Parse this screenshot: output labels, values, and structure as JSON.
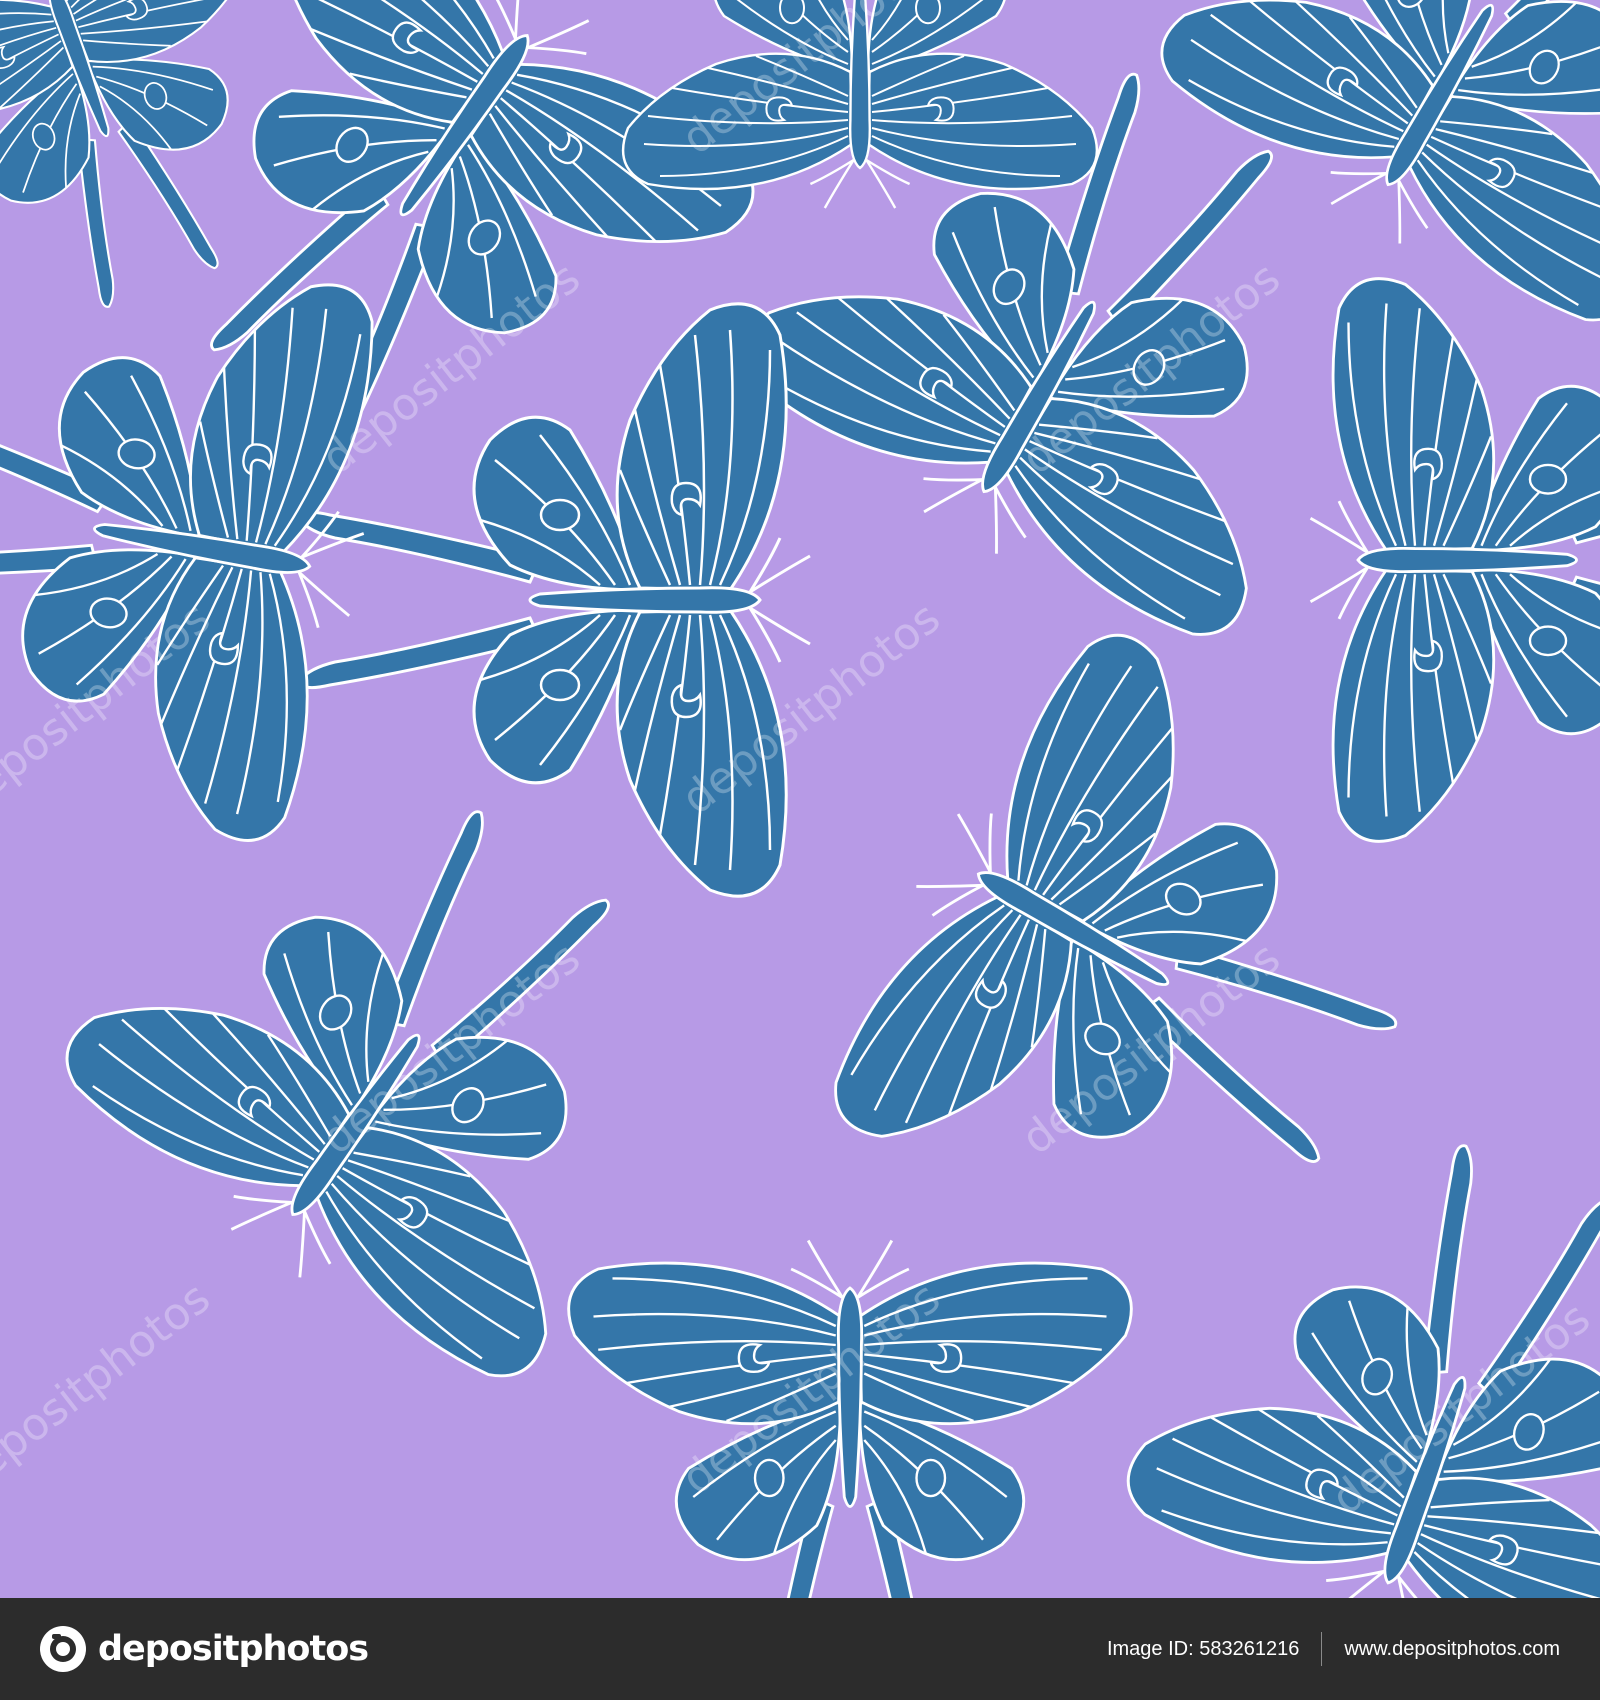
{
  "colors": {
    "background": "#b79ae6",
    "moth_fill": "#3476a9",
    "moth_outline": "#ffffff",
    "footer_bg": "#2c2c2c"
  },
  "pattern": {
    "subject": "luna moth",
    "moth_count": 12
  },
  "watermark": {
    "text": "depositphotos"
  },
  "footer": {
    "logo_icon": "camera-logo-icon",
    "brand": "depositphotos",
    "image_id_label": "Image ID:",
    "image_id": "583261216",
    "url": "www.depositphotos.com"
  }
}
